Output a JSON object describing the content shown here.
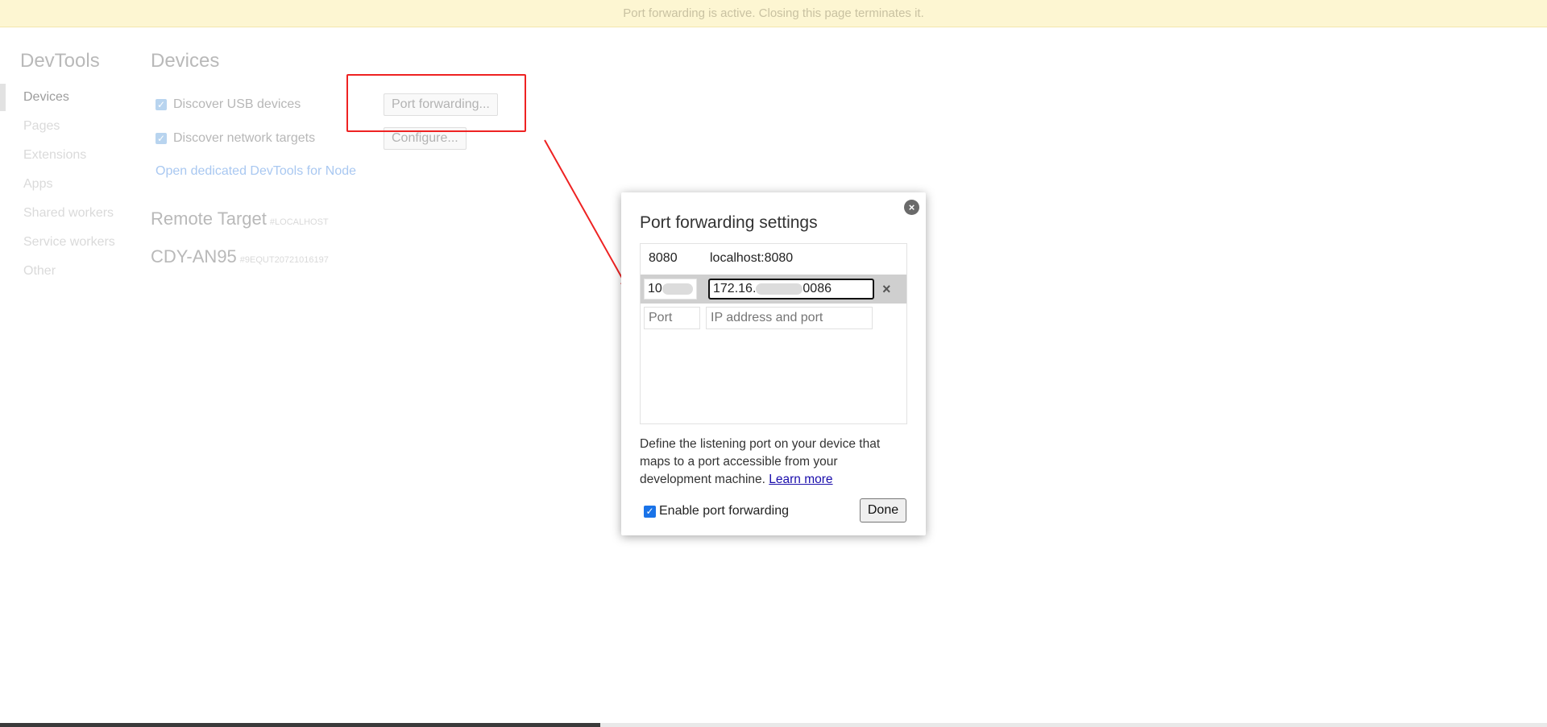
{
  "banner": {
    "text": "Port forwarding is active. Closing this page terminates it."
  },
  "sidebar": {
    "title": "DevTools",
    "items": [
      {
        "label": "Devices",
        "active": true
      },
      {
        "label": "Pages"
      },
      {
        "label": "Extensions"
      },
      {
        "label": "Apps"
      },
      {
        "label": "Shared workers"
      },
      {
        "label": "Service workers"
      },
      {
        "label": "Other"
      }
    ]
  },
  "main": {
    "title": "Devices",
    "discover_usb": {
      "label": "Discover USB devices",
      "checked": true
    },
    "discover_network": {
      "label": "Discover network targets",
      "checked": true
    },
    "port_forwarding_button": "Port forwarding...",
    "configure_button": "Configure...",
    "node_link": "Open dedicated DevTools for Node",
    "remote_target": {
      "title": "Remote Target",
      "tag": "#LOCALHOST"
    },
    "device": {
      "name": "CDY-AN95",
      "serial": "#9EQUT20721016197"
    }
  },
  "dialog": {
    "title": "Port forwarding settings",
    "rules": [
      {
        "port": "8080",
        "address": "localhost:8080"
      }
    ],
    "editing_rule": {
      "port_visible": "10",
      "address_prefix": "172.16.",
      "address_suffix": "0086",
      "remove_label": "×"
    },
    "new_rule": {
      "port_placeholder": "Port",
      "address_placeholder": "IP address and port"
    },
    "description": "Define the listening port on your device that maps to a port accessible from your development machine.",
    "learn_more": "Learn more",
    "enable_forwarding": {
      "label": "Enable port forwarding",
      "checked": true
    },
    "done_button": "Done",
    "close_label": "×"
  },
  "colors": {
    "highlight": "#ee2222",
    "annotation_arrow": "#ee2222",
    "banner_bg": "#fdf6d2",
    "checkbox_blue": "#1a73e8"
  }
}
